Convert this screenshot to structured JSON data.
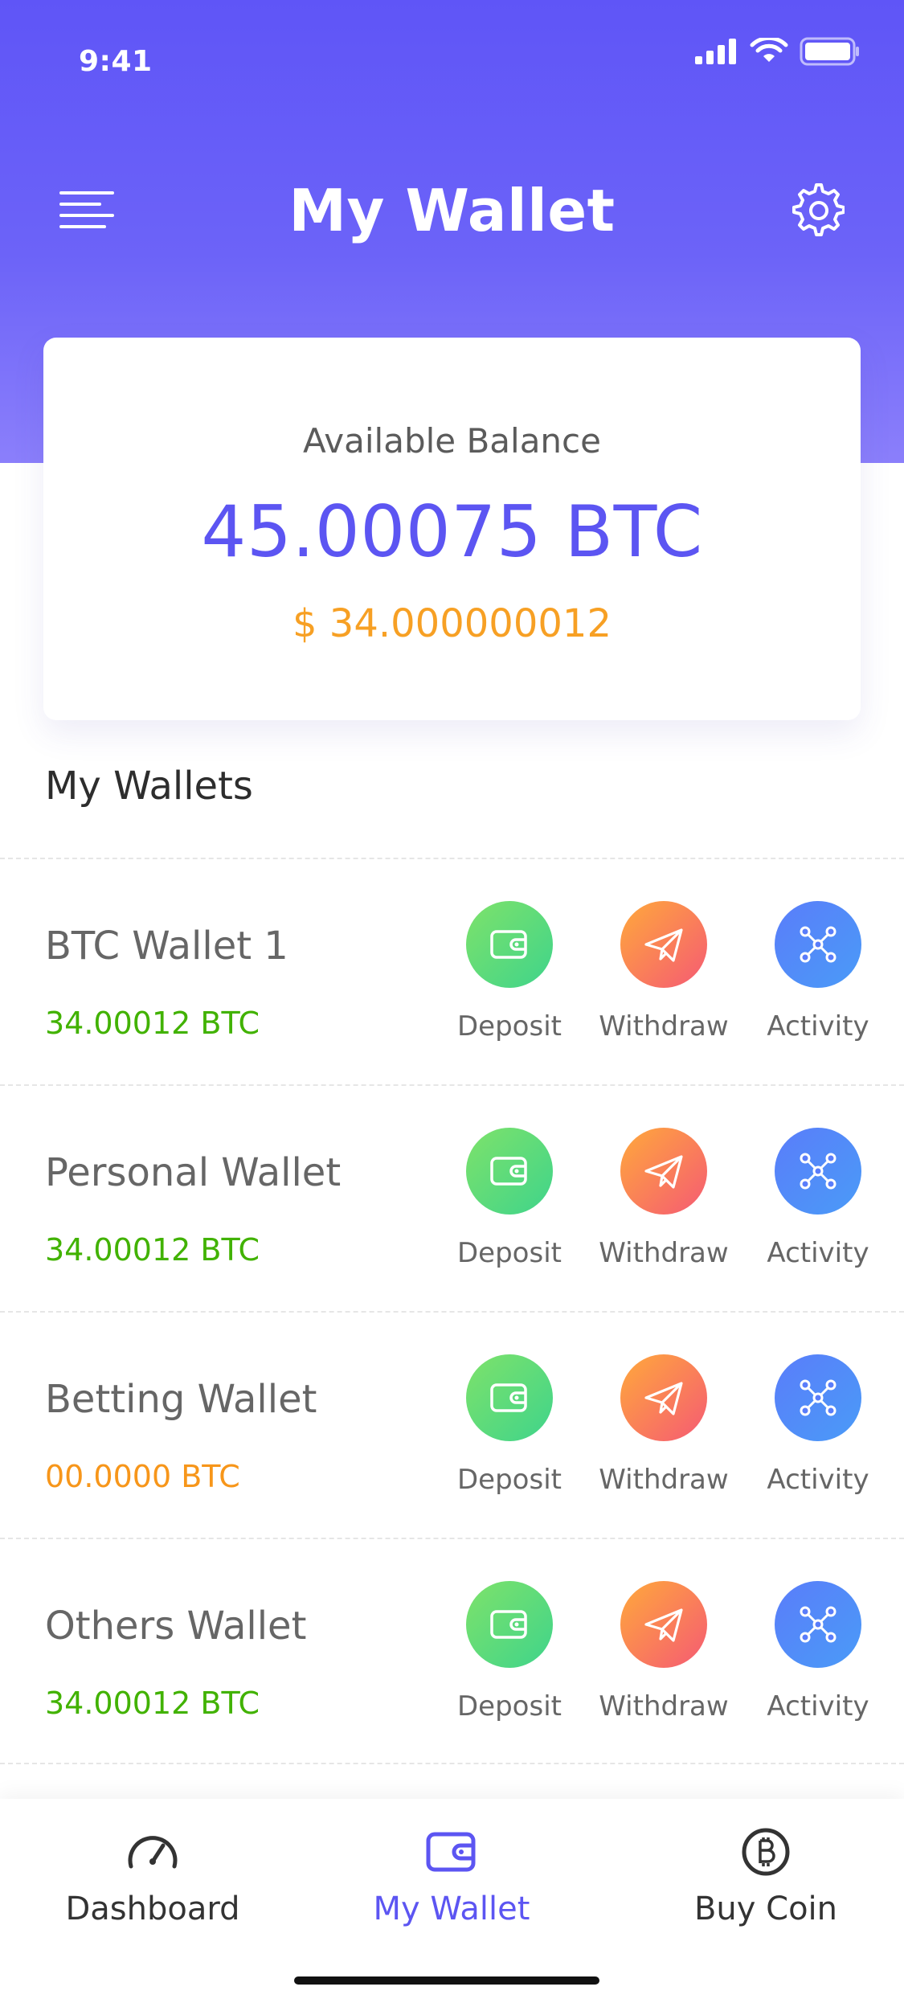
{
  "status_bar": {
    "time": "9:41"
  },
  "header": {
    "title": "My Wallet"
  },
  "balance": {
    "label": "Available Balance",
    "btc": "45.00075 BTC",
    "usd": "$ 34.000000012"
  },
  "wallets_section": {
    "title": "My Wallets"
  },
  "actions": {
    "deposit": "Deposit",
    "withdraw": "Withdraw",
    "activity": "Activity"
  },
  "wallets": [
    {
      "name": "BTC Wallet 1",
      "amount": "34.00012 BTC",
      "amount_color": "#41b200"
    },
    {
      "name": "Personal Wallet",
      "amount": "34.00012 BTC",
      "amount_color": "#41b200"
    },
    {
      "name": "Betting Wallet",
      "amount": "00.0000 BTC",
      "amount_color": "#f7961a"
    },
    {
      "name": "Others Wallet",
      "amount": "34.00012 BTC",
      "amount_color": "#41b200"
    }
  ],
  "tabs": [
    {
      "label": "Dashboard",
      "icon": "speedometer-icon"
    },
    {
      "label": "My Wallet",
      "icon": "wallet-icon"
    },
    {
      "label": "Buy Coin",
      "icon": "bitcoin-icon"
    }
  ],
  "colors": {
    "accent": "#5c55f2",
    "positive": "#41b200",
    "warning": "#f7961a"
  }
}
